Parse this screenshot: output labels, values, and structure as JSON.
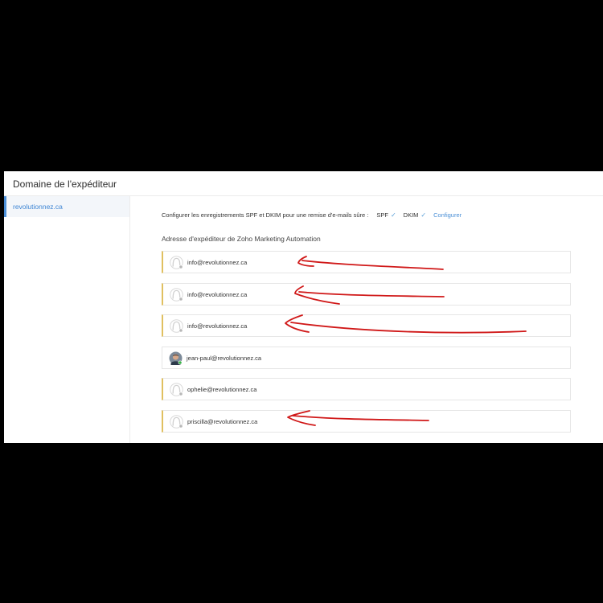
{
  "panel": {
    "title": "Domaine de l'expéditeur"
  },
  "sidebar": {
    "items": [
      {
        "label": "revolutionnez.ca",
        "selected": true
      }
    ]
  },
  "config": {
    "text": "Configurer les enregistrements SPF et DKIM pour une remise d'e-mails sûre :",
    "spf_label": "SPF",
    "dkim_label": "DKIM",
    "status_icon": "check-icon",
    "configure_label": "Configurer"
  },
  "section": {
    "title": "Adresse d'expéditeur de Zoho Marketing Automation"
  },
  "addresses": [
    {
      "email": "info@revolutionnez.ca",
      "avatar": "default-avatar-icon",
      "status": "offline",
      "accent": true
    },
    {
      "email": "info@revolutionnez.ca",
      "avatar": "default-avatar-icon",
      "status": "offline",
      "accent": true
    },
    {
      "email": "info@revolutionnez.ca",
      "avatar": "default-avatar-icon",
      "status": "offline",
      "accent": true
    },
    {
      "email": "jean-paul@revolutionnez.ca",
      "avatar": "user-photo",
      "status": "online",
      "accent": false
    },
    {
      "email": "ophelie@revolutionnez.ca",
      "avatar": "default-avatar-icon",
      "status": "offline",
      "accent": true
    },
    {
      "email": "priscilla@revolutionnez.ca",
      "avatar": "default-avatar-icon",
      "status": "offline",
      "accent": true
    }
  ],
  "annotations": {
    "arrow_color": "#d01818",
    "arrows_point_to": [
      "info@revolutionnez.ca",
      "info@revolutionnez.ca",
      "info@revolutionnez.ca",
      "priscilla@revolutionnez.ca"
    ]
  },
  "colors": {
    "accent": "#4b8fd8",
    "row_accent": "#e0c060",
    "status_online": "#3cb34a",
    "status_offline": "#b8b8b8"
  }
}
